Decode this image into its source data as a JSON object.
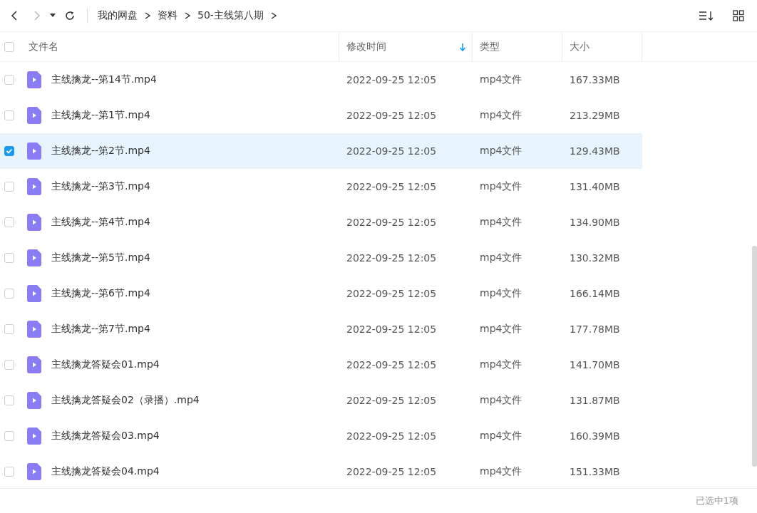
{
  "toolbar": {
    "breadcrumb": [
      {
        "label": "我的网盘"
      },
      {
        "label": "资料"
      },
      {
        "label": "50-主线第八期"
      }
    ],
    "forward_disabled": true
  },
  "table": {
    "all_checked": false,
    "columns": [
      {
        "label": "文件名",
        "sorted": false
      },
      {
        "label": "修改时间",
        "sorted": true
      },
      {
        "label": "类型",
        "sorted": false
      },
      {
        "label": "大小",
        "sorted": false
      }
    ],
    "rows": [
      {
        "name": "主线擒龙--第14节.mp4",
        "modified": "2022-09-25 12:05",
        "type": "mp4文件",
        "size": "167.33MB",
        "selected": false
      },
      {
        "name": "主线擒龙--第1节.mp4",
        "modified": "2022-09-25 12:05",
        "type": "mp4文件",
        "size": "213.29MB",
        "selected": false
      },
      {
        "name": "主线擒龙--第2节.mp4",
        "modified": "2022-09-25 12:05",
        "type": "mp4文件",
        "size": "129.43MB",
        "selected": true
      },
      {
        "name": "主线擒龙--第3节.mp4",
        "modified": "2022-09-25 12:05",
        "type": "mp4文件",
        "size": "131.40MB",
        "selected": false
      },
      {
        "name": "主线擒龙--第4节.mp4",
        "modified": "2022-09-25 12:05",
        "type": "mp4文件",
        "size": "134.90MB",
        "selected": false
      },
      {
        "name": "主线擒龙--第5节.mp4",
        "modified": "2022-09-25 12:05",
        "type": "mp4文件",
        "size": "130.32MB",
        "selected": false
      },
      {
        "name": "主线擒龙--第6节.mp4",
        "modified": "2022-09-25 12:05",
        "type": "mp4文件",
        "size": "166.14MB",
        "selected": false
      },
      {
        "name": "主线擒龙--第7节.mp4",
        "modified": "2022-09-25 12:05",
        "type": "mp4文件",
        "size": "177.78MB",
        "selected": false
      },
      {
        "name": "主线擒龙答疑会01.mp4",
        "modified": "2022-09-25 12:05",
        "type": "mp4文件",
        "size": "141.70MB",
        "selected": false
      },
      {
        "name": "主线擒龙答疑会02（录播）.mp4",
        "modified": "2022-09-25 12:05",
        "type": "mp4文件",
        "size": "131.87MB",
        "selected": false
      },
      {
        "name": "主线擒龙答疑会03.mp4",
        "modified": "2022-09-25 12:05",
        "type": "mp4文件",
        "size": "160.39MB",
        "selected": false
      },
      {
        "name": "主线擒龙答疑会04.mp4",
        "modified": "2022-09-25 12:05",
        "type": "mp4文件",
        "size": "151.33MB",
        "selected": false
      }
    ]
  },
  "status_bar": {
    "text": "已选中1项"
  }
}
